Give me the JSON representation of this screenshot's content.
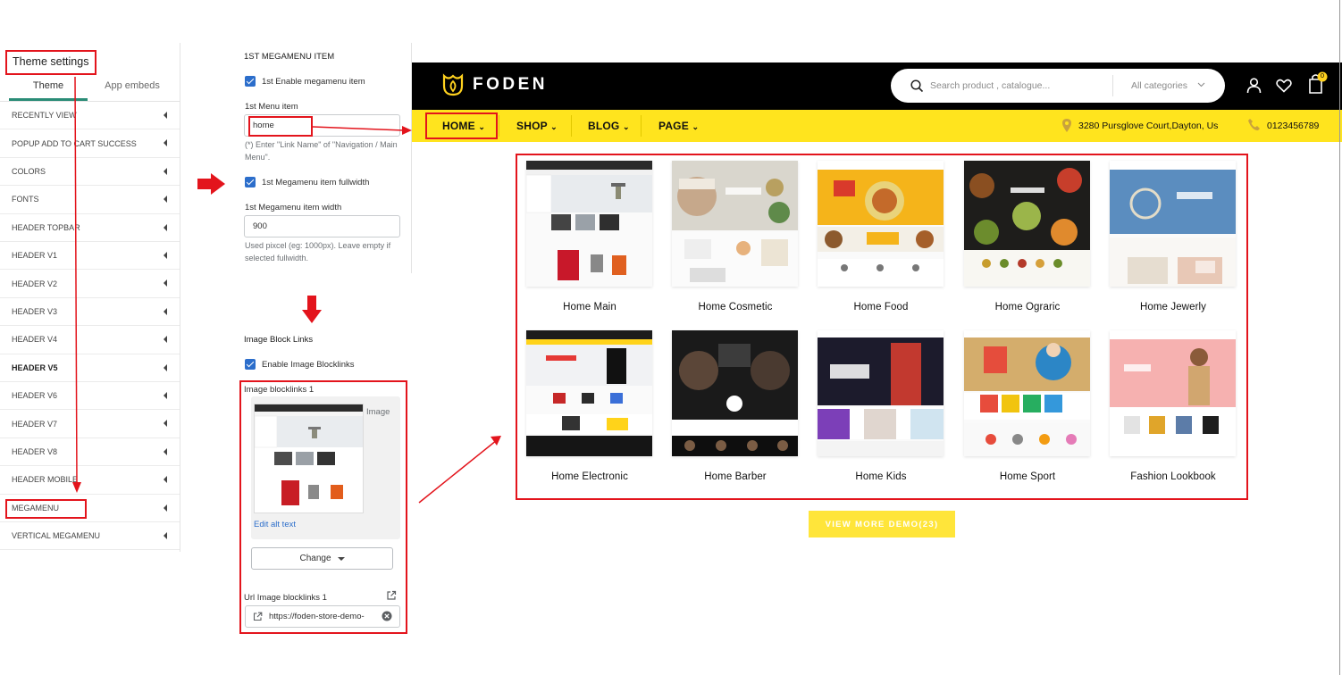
{
  "sidebar": {
    "title": "Theme settings",
    "tabs": [
      {
        "label": "Theme"
      },
      {
        "label": "App embeds"
      }
    ],
    "items": [
      {
        "label": "RECENTLY VIEW"
      },
      {
        "label": "POPUP ADD TO CART SUCCESS"
      },
      {
        "label": "COLORS"
      },
      {
        "label": "FONTS"
      },
      {
        "label": "HEADER TOPBAR"
      },
      {
        "label": "HEADER V1"
      },
      {
        "label": "HEADER V2"
      },
      {
        "label": "HEADER V3"
      },
      {
        "label": "HEADER V4"
      },
      {
        "label": "HEADER V5"
      },
      {
        "label": "HEADER V6"
      },
      {
        "label": "HEADER V7"
      },
      {
        "label": "HEADER V8"
      },
      {
        "label": "HEADER MOBILE"
      },
      {
        "label": "MEGAMENU"
      },
      {
        "label": "VERTICAL MEGAMENU"
      }
    ]
  },
  "settings": {
    "section_title": "1ST MEGAMENU ITEM",
    "enable_label": "1st Enable megamenu item",
    "menu_item_label": "1st Menu item",
    "menu_item_value": "home",
    "menu_item_hint": "(*) Enter \"Link Name\" of \"Navigation / Main Menu\".",
    "fullwidth_label": "1st Megamenu item fullwidth",
    "width_label": "1st Megamenu item width",
    "width_value": "900",
    "width_hint": "Used pixcel (eg: 1000px). Leave empty if selected fullwidth.",
    "blocklinks_title": "Image Block Links",
    "enable_blocklinks_label": "Enable Image Blocklinks",
    "blocklinks_1_label": "Image blocklinks 1",
    "image_label": "Image",
    "edit_alt": "Edit alt text",
    "change_button": "Change",
    "url_label": "Url Image blocklinks 1",
    "url_value": "https://foden-store-demo-"
  },
  "store": {
    "logo": "FODEN",
    "search_placeholder": "Search product , catalogue...",
    "category_select": "All categories",
    "cart_count": "0",
    "nav": [
      {
        "label": "HOME"
      },
      {
        "label": "SHOP"
      },
      {
        "label": "BLOG"
      },
      {
        "label": "PAGE"
      }
    ],
    "address": "3280 Pursglove Court,Dayton, Us",
    "phone": "0123456789",
    "demos": [
      {
        "title": "Home Main",
        "color": "#f2f2f2"
      },
      {
        "title": "Home Cosmetic",
        "color": "#d9d3c7"
      },
      {
        "title": "Home Food",
        "color": "#f5b81c"
      },
      {
        "title": "Home Ograric",
        "color": "#1e1e1e"
      },
      {
        "title": "Home Jewerly",
        "color": "#5d8fc1"
      },
      {
        "title": "Home Electronic",
        "color": "#ececec"
      },
      {
        "title": "Home Barber",
        "color": "#161616"
      },
      {
        "title": "Home Kids",
        "color": "#1d1d2b"
      },
      {
        "title": "Home Sport",
        "color": "#cfa566"
      },
      {
        "title": "Fashion Lookbook",
        "color": "#f4a9a8"
      }
    ],
    "view_more": "VIEW MORE DEMO(23)"
  },
  "colors": {
    "accent_yellow": "#ffe41e",
    "annotation_red": "#e3141c",
    "checkbox_blue": "#2c6ecb",
    "tab_underline": "#2a8c76"
  }
}
